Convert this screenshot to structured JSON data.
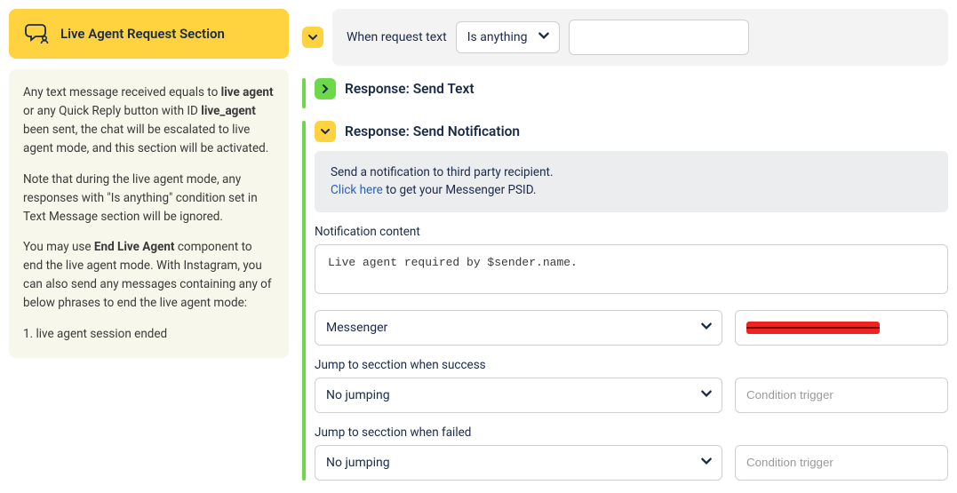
{
  "left": {
    "header_title": "Live Agent Request Section",
    "info": {
      "p1_prefix": "Any text message received equals to ",
      "p1_bold1": "live agent",
      "p1_mid": " or any Quick Reply button with ID ",
      "p1_bold2": "live_agent",
      "p1_suffix": " been sent, the chat will be escalated to live agent mode, and this section will be activated.",
      "p2": "Note that during the live agent mode, any responses with \"Is anything\" condition set in Text Message section will be ignored.",
      "p3_prefix": "You may use ",
      "p3_bold": "End Live Agent",
      "p3_suffix": " component to end the live agent mode. With Instagram, you can also send any messages containing any of below phrases to end the live agent mode:",
      "p4": "1. live agent session ended"
    }
  },
  "when": {
    "label": "When request text",
    "select_value": "Is anything",
    "input_value": ""
  },
  "resp_text": {
    "title": "Response: Send Text"
  },
  "resp_notif": {
    "title": "Response: Send Notification",
    "notice_line1": "Send a notification to third party recipient.",
    "notice_link": "Click here",
    "notice_rest": " to get your Messenger PSID.",
    "content_label": "Notification content",
    "content_value": "Live agent required by $sender.name.",
    "channel_value": "Messenger",
    "jump_success_label": "Jump to secction when success",
    "jump_success_value": "No jumping",
    "jump_failed_label": "Jump to secction when failed",
    "jump_failed_value": "No jumping",
    "trigger_placeholder": "Condition trigger"
  }
}
